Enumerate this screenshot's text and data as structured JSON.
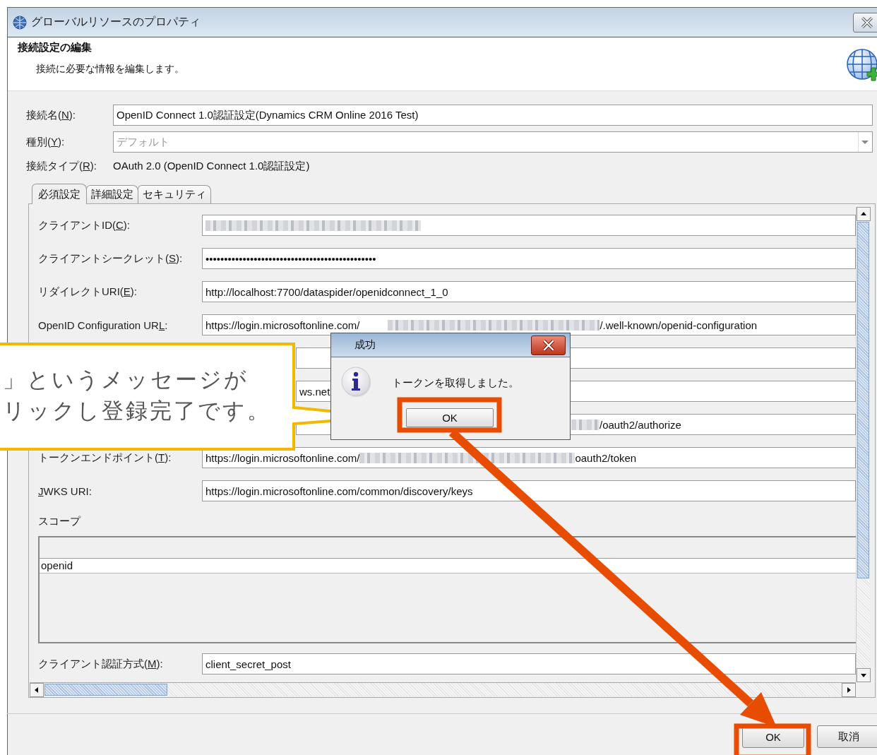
{
  "window": {
    "title": "グローバルリソースのプロパティ"
  },
  "header": {
    "title": "接続設定の編集",
    "description": "接続に必要な情報を編集します。"
  },
  "general_fields": [
    {
      "kind": "text",
      "label_before": "接続名(",
      "mnemonic": "N",
      "label_after": "):",
      "value": "OpenID Connect 1.0認証設定(Dynamics CRM Online 2016 Test)"
    },
    {
      "kind": "combo",
      "label_before": "種別(",
      "mnemonic": "Y",
      "label_after": "):",
      "value": "デフォルト",
      "disabled": true
    },
    {
      "kind": "static",
      "label_before": "接続タイプ(",
      "mnemonic": "R",
      "label_after": "):",
      "value": "OAuth 2.0 (OpenID Connect 1.0認証設定)"
    }
  ],
  "tabs": [
    {
      "label": "必須設定",
      "selected": true
    },
    {
      "label": "詳細設定",
      "selected": false
    },
    {
      "label": "セキュリティ",
      "selected": false
    }
  ],
  "required_fields": [
    {
      "kind": "labeled",
      "label_before": "クライアントID(",
      "mnemonic": "C",
      "label_after": "):",
      "segments": [
        {
          "kind": "blur"
        }
      ]
    },
    {
      "kind": "labeled",
      "label_before": "クライアントシークレット(",
      "mnemonic": "S",
      "label_after": "):",
      "segments": [
        {
          "kind": "text",
          "text": "••••••••••••••••••••••••••••••••••••••••••••••"
        }
      ]
    },
    {
      "kind": "labeled",
      "label_before": "リダイレクトURI(",
      "mnemonic": "E",
      "label_after": "):",
      "segments": [
        {
          "kind": "text",
          "text": "http://localhost:7700/dataspider/openidconnect_1_0"
        }
      ]
    },
    {
      "kind": "labeled",
      "label_before": "OpenID Configuration UR",
      "mnemonic": "L",
      "label_after": ":",
      "segments": [
        {
          "kind": "text",
          "text": "https://login.microsoftonline.com/"
        },
        {
          "kind": "blur"
        },
        {
          "kind": "text",
          "text": "/.well-known/openid-configuration"
        }
      ]
    },
    {
      "kind": "covered"
    },
    {
      "kind": "covered",
      "segments": [
        {
          "kind": "text",
          "text": "ws.net"
        }
      ]
    },
    {
      "kind": "covered",
      "segments": [
        {
          "kind": "blur"
        },
        {
          "kind": "text",
          "text": "/oauth2/authorize"
        }
      ]
    },
    {
      "kind": "labeled",
      "label_before": "トークンエンドポイント(",
      "mnemonic": "T",
      "label_after": "):",
      "segments": [
        {
          "kind": "text",
          "text": "https://login.microsoftonline.com/"
        },
        {
          "kind": "blur"
        },
        {
          "kind": "text",
          "text": "oauth2/token"
        }
      ]
    },
    {
      "kind": "labeled",
      "mnemonic": "J",
      "label_after": "WKS URI:",
      "segments": [
        {
          "kind": "text",
          "text": "https://login.microsoftonline.com/common/discovery/keys"
        }
      ]
    }
  ],
  "scope": {
    "label": "スコープ",
    "rows": [
      "openid"
    ]
  },
  "auth_method": {
    "label_before": "クライアント認証方式(",
    "mnemonic": "M",
    "label_after": "):",
    "value": "client_secret_post"
  },
  "buttons": [
    {
      "label": "OK"
    },
    {
      "label": "取消"
    }
  ],
  "message_dialog": {
    "title": "成功",
    "message": "トークンを取得しました。",
    "button": "OK"
  },
  "callout": {
    "lines": [
      "」というメッセージが",
      "リックし登録完了です。"
    ]
  }
}
